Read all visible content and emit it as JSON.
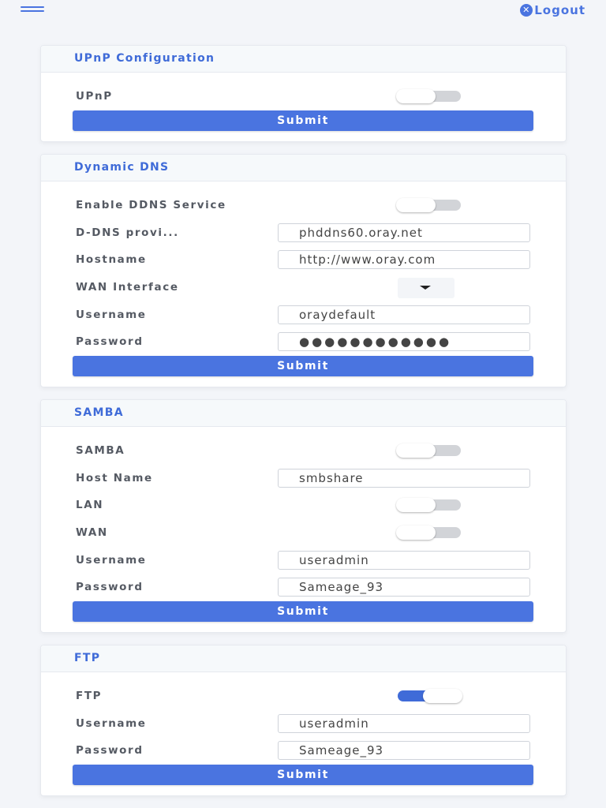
{
  "colors": {
    "accent": "#4a74e0",
    "title": "#3f6bd8",
    "label": "#555a63",
    "background": "#f3f5f9"
  },
  "header": {
    "menu_icon": "hamburger-icon",
    "logout_icon": "close-circle-icon",
    "logout_label": "Logout"
  },
  "upnp": {
    "title": "UPnP Configuration",
    "upnp_label": "UPnP",
    "upnp_enabled": false,
    "submit_label": "Submit"
  },
  "ddns": {
    "title": "Dynamic DNS",
    "enable_label": "Enable DDNS Service",
    "enable_enabled": false,
    "provider_label": "D-DNS provi...",
    "provider_value": "phddns60.oray.net",
    "hostname_label": "Hostname",
    "hostname_value": "http://www.oray.com",
    "wan_label": "WAN Interface",
    "username_label": "Username",
    "username_value": "oraydefault",
    "password_label": "Password",
    "password_value": "●●●●●●●●●●●●",
    "submit_label": "Submit"
  },
  "samba": {
    "title": "SAMBA",
    "samba_label": "SAMBA",
    "samba_enabled": false,
    "hostname_label": "Host Name",
    "hostname_value": "smbshare",
    "lan_label": "LAN",
    "lan_enabled": false,
    "wan_label": "WAN",
    "wan_enabled": false,
    "username_label": "Username",
    "username_value": "useradmin",
    "password_label": "Password",
    "password_value": "Sameage_93",
    "submit_label": "Submit"
  },
  "ftp": {
    "title": "FTP",
    "ftp_label": "FTP",
    "ftp_enabled": true,
    "username_label": "Username",
    "username_value": "useradmin",
    "password_label": "Password",
    "password_value": "Sameage_93",
    "submit_label": "Submit"
  }
}
